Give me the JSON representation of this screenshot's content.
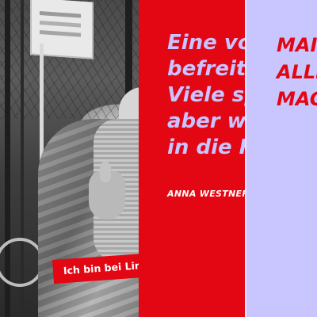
{
  "photo": {
    "badge_text": "Ich bin bei Linke"
  },
  "quote_panel": {
    "lines": [
      "Eine vo",
      "befreit",
      "Viele sp",
      "aber w",
      "in die K"
    ],
    "author": "ANNA WESTNER"
  },
  "slogan_panel": {
    "lines": [
      "MAI",
      "ALLI",
      "MAC"
    ]
  },
  "colors": {
    "red": "#e30613",
    "lavender": "#c9c6ff",
    "quote_text": "#c9c3ff",
    "white": "#ffffff"
  }
}
